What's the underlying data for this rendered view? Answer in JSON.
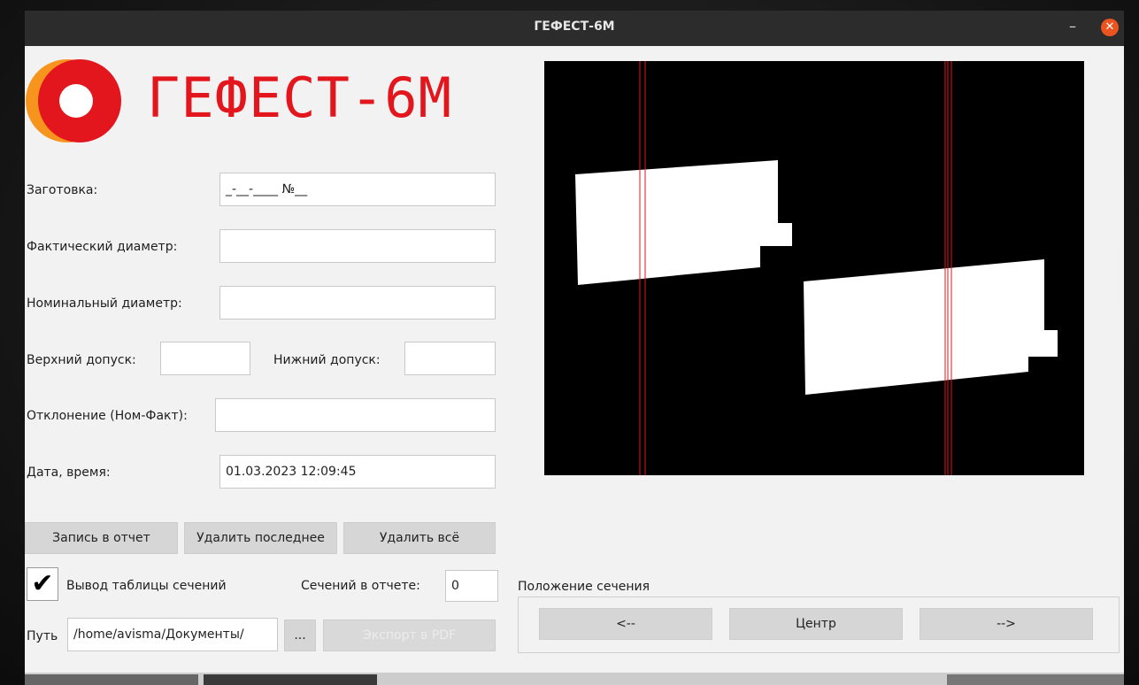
{
  "window": {
    "title": "ГЕФЕСТ-6М",
    "minimize_glyph": "–",
    "close_glyph": "✕"
  },
  "logo": {
    "text": "ГЕФЕСТ-6М"
  },
  "form": {
    "zagotovka_label": "Заготовка:",
    "zagotovka_value": "_-__-____ №__",
    "fact_diam_label": "Фактический диаметр:",
    "fact_diam_value": "",
    "nom_diam_label": "Номинальный диаметр:",
    "nom_diam_value": "",
    "upper_tol_label": "Верхний допуск:",
    "upper_tol_value": "",
    "lower_tol_label": "Нижний допуск:",
    "lower_tol_value": "",
    "deviation_label": "Отклонение (Ном-Факт):",
    "deviation_value": "",
    "datetime_label": "Дата, время:",
    "datetime_value": "01.03.2023 12:09:45"
  },
  "buttons": {
    "record": "Запись в отчет",
    "delete_last": "Удалить последнее",
    "delete_all": "Удалить всё",
    "browse": "...",
    "export_pdf": "Экспорт в PDF"
  },
  "options": {
    "table_output_label": "Вывод таблицы сечений",
    "table_output_checked": true,
    "check_glyph": "✔",
    "sections_label": "Сечений в отчете:",
    "sections_value": "0",
    "path_label": "Путь",
    "path_value": "/home/avisma/Документы/"
  },
  "section_position": {
    "label": "Положение сечения",
    "left": "<--",
    "center": "Центр",
    "right": "-->"
  },
  "colors": {
    "accent": "#e3161e",
    "close": "#e95420",
    "logo_orange": "#f7941d"
  },
  "icons": [
    "minimize-icon",
    "close-icon",
    "logo-ring-icon",
    "checkmark-icon"
  ]
}
